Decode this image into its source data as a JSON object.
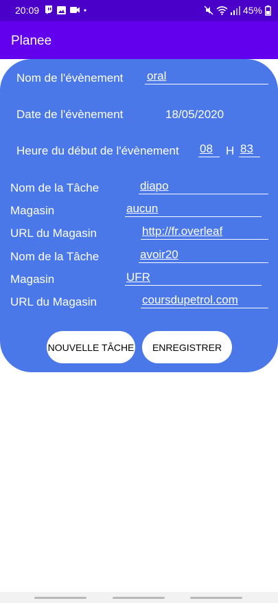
{
  "status_bar": {
    "time": "20:09",
    "battery": "45%"
  },
  "app_bar": {
    "title": "Planee"
  },
  "form": {
    "event_name_label": "Nom de l'évènement",
    "event_name_value": "oral",
    "event_date_label": "Date de l'évènement",
    "event_date_value": "18/05/2020",
    "start_time_label": "Heure du début de l'évènement",
    "start_hour": "08",
    "hour_separator": "H",
    "start_minute": "83",
    "tasks": [
      {
        "task_label": "Nom de la Tâche",
        "task_value": "diapo",
        "store_label": "Magasin",
        "store_value": "aucun",
        "url_label": "URL du Magasin",
        "url_value": "http://fr.overleaf"
      },
      {
        "task_label": "Nom de la Tâche",
        "task_value": "avoir20",
        "store_label": "Magasin",
        "store_value": "UFR",
        "url_label": "URL du Magasin",
        "url_value": "coursdupetrol.com"
      }
    ]
  },
  "buttons": {
    "new_task": "NOUVELLE TÂCHE",
    "save": "ENREGISTRER"
  },
  "colors": {
    "status_bar": "#4a00c8",
    "app_bar": "#6200ee",
    "card": "#4a78e8"
  }
}
